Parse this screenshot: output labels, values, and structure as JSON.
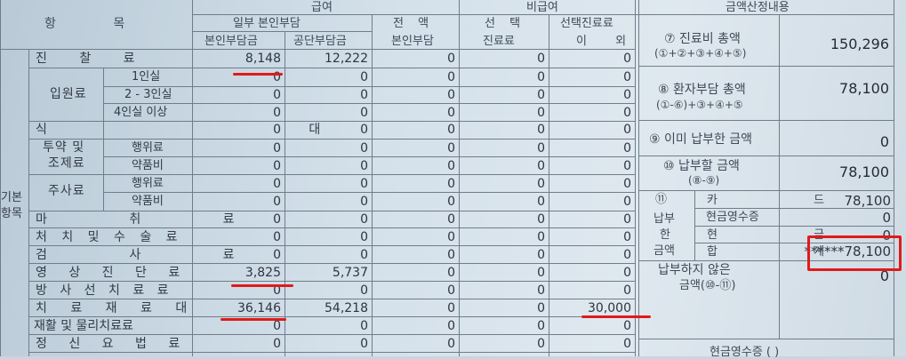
{
  "header": {
    "hangmok": "항 목",
    "geupyeo": "급여",
    "bigeupyeo": "비급여",
    "calc_title": "금액산정내용",
    "ilbu": "일부 본인부담",
    "bonin": "본인부담금",
    "gongdan": "공단부담금",
    "jeonaek1": "전 액",
    "jeonaek2": "본인부담",
    "seontaek1": "선 택",
    "seontaek2": "진료료",
    "seontaek_oe1": "선택진료료",
    "seontaek_oe2": "이 외"
  },
  "rows": {
    "jinchal": {
      "label": "진 찰 료",
      "bonin": "8,148",
      "gongdan": "12,222",
      "jeonaek": "0",
      "seontaek": "0",
      "oe": "0"
    },
    "ipwon_group": "입원료",
    "ipwon1": {
      "label": "1인실",
      "bonin": "0",
      "gongdan": "0",
      "jeonaek": "0",
      "seontaek": "0",
      "oe": "0"
    },
    "ipwon23": {
      "label": "2 - 3인실",
      "bonin": "0",
      "gongdan": "0",
      "jeonaek": "0",
      "seontaek": "0",
      "oe": "0"
    },
    "ipwon4": {
      "label": "4인실 이상",
      "bonin": "0",
      "gongdan": "0",
      "jeonaek": "0",
      "seontaek": "0",
      "oe": "0"
    },
    "sikdae": {
      "label": "식 대",
      "bonin": "0",
      "gongdan": "0",
      "jeonaek": "0",
      "seontaek": "0",
      "oe": "0"
    },
    "tuyak_group1": "투약 및",
    "tuyak_group2": "조제료",
    "tuyak_haeng": {
      "label": "행위료",
      "bonin": "0",
      "gongdan": "0",
      "jeonaek": "0",
      "seontaek": "0",
      "oe": "0"
    },
    "tuyak_yak": {
      "label": "약품비",
      "bonin": "0",
      "gongdan": "0",
      "jeonaek": "0",
      "seontaek": "0",
      "oe": "0"
    },
    "jusa_group": "주사료",
    "jusa_haeng": {
      "label": "행위료",
      "bonin": "0",
      "gongdan": "0",
      "jeonaek": "0",
      "seontaek": "0",
      "oe": "0"
    },
    "jusa_yak": {
      "label": "약품비",
      "bonin": "0",
      "gongdan": "0",
      "jeonaek": "0",
      "seontaek": "0",
      "oe": "0"
    },
    "machwi": {
      "label": "마 취 료",
      "bonin": "0",
      "gongdan": "0",
      "jeonaek": "0",
      "seontaek": "0",
      "oe": "0"
    },
    "cheochi": {
      "label": "처 치 및 수 술 료",
      "bonin": "0",
      "gongdan": "0",
      "jeonaek": "0",
      "seontaek": "0",
      "oe": "0"
    },
    "geomsa": {
      "label": "검 사 료",
      "bonin": "0",
      "gongdan": "0",
      "jeonaek": "0",
      "seontaek": "0",
      "oe": "0"
    },
    "yeongsang": {
      "label": "영 상 진 단 료",
      "bonin": "3,825",
      "gongdan": "5,737",
      "jeonaek": "0",
      "seontaek": "0",
      "oe": "0"
    },
    "bangsa": {
      "label": "방 사 선 치 료 료",
      "bonin": "0",
      "gongdan": "0",
      "jeonaek": "0",
      "seontaek": "0",
      "oe": "0"
    },
    "chiryo": {
      "label": "치 료 재 료 대",
      "bonin": "36,146",
      "gongdan": "54,218",
      "jeonaek": "0",
      "seontaek": "0",
      "oe": "30,000"
    },
    "jaehwal": {
      "label": "재활 및 물리치료료",
      "bonin": "0",
      "gongdan": "0",
      "jeonaek": "0",
      "seontaek": "0",
      "oe": "0"
    },
    "jeongsin": {
      "label": "정 신 요 법 료",
      "bonin": "0",
      "gongdan": "0",
      "jeonaek": "0",
      "seontaek": "0",
      "oe": "0"
    }
  },
  "side_label1": "기본",
  "side_label2": "항목",
  "calc": {
    "c7_title": "⑦ 진료비 총액",
    "c7_formula": "(①+②+③+④+⑤)",
    "c7_value": "150,296",
    "c8_title": "⑧ 환자부담 총액",
    "c8_formula": "(①-⑥)+③+④+⑤",
    "c8_value": "78,100",
    "c9_title": "⑨ 이미 납부한 금액",
    "c9_value": "0",
    "c10_title": "⑩ 납부할 금액",
    "c10_formula": "(⑧-⑨)",
    "c10_value": "78,100",
    "c11_num": "⑪",
    "c11_l1": "납부",
    "c11_l2": "한",
    "c11_l3": "금액",
    "card_label": "카 드",
    "card_value": "78,100",
    "cash_label": "현금영수증",
    "cash_value": "0",
    "hyeongeum_label": "현 금",
    "hyeongeum_value": "0",
    "total_label": "합 계",
    "total_value": "******78,100",
    "unpaid1": "납부하지 않은",
    "unpaid2": "금액(⑩-⑪)",
    "unpaid_value": "0",
    "bottom_cut": "현금영수증 ( )"
  },
  "colors": {
    "highlight": "#e01a1a",
    "paper": "#d3e0ea",
    "ink": "#2a2f38"
  }
}
